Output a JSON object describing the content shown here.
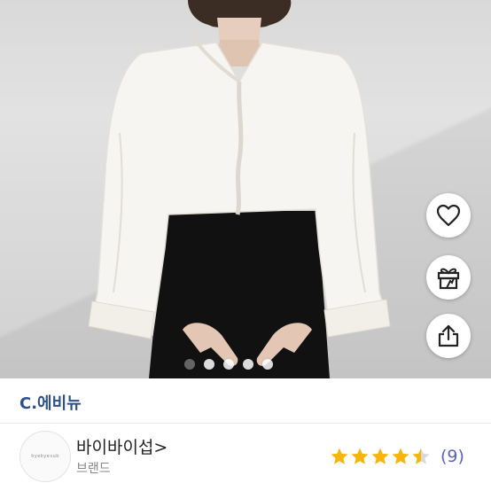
{
  "store": {
    "name": "C.에비뉴"
  },
  "seller": {
    "name": "바이바이섭",
    "chevron": ">",
    "type": "브랜드",
    "logo_text": "byebyesub"
  },
  "rating": {
    "stars": 4.5,
    "max": 5,
    "count": "(9)",
    "star_color": "#f5b50a"
  },
  "carousel": {
    "count": 5,
    "active_index": 0
  },
  "actions": [
    {
      "id": "favorite",
      "icon": "heart-icon"
    },
    {
      "id": "gift",
      "icon": "gift-icon"
    },
    {
      "id": "share",
      "icon": "share-icon"
    }
  ]
}
